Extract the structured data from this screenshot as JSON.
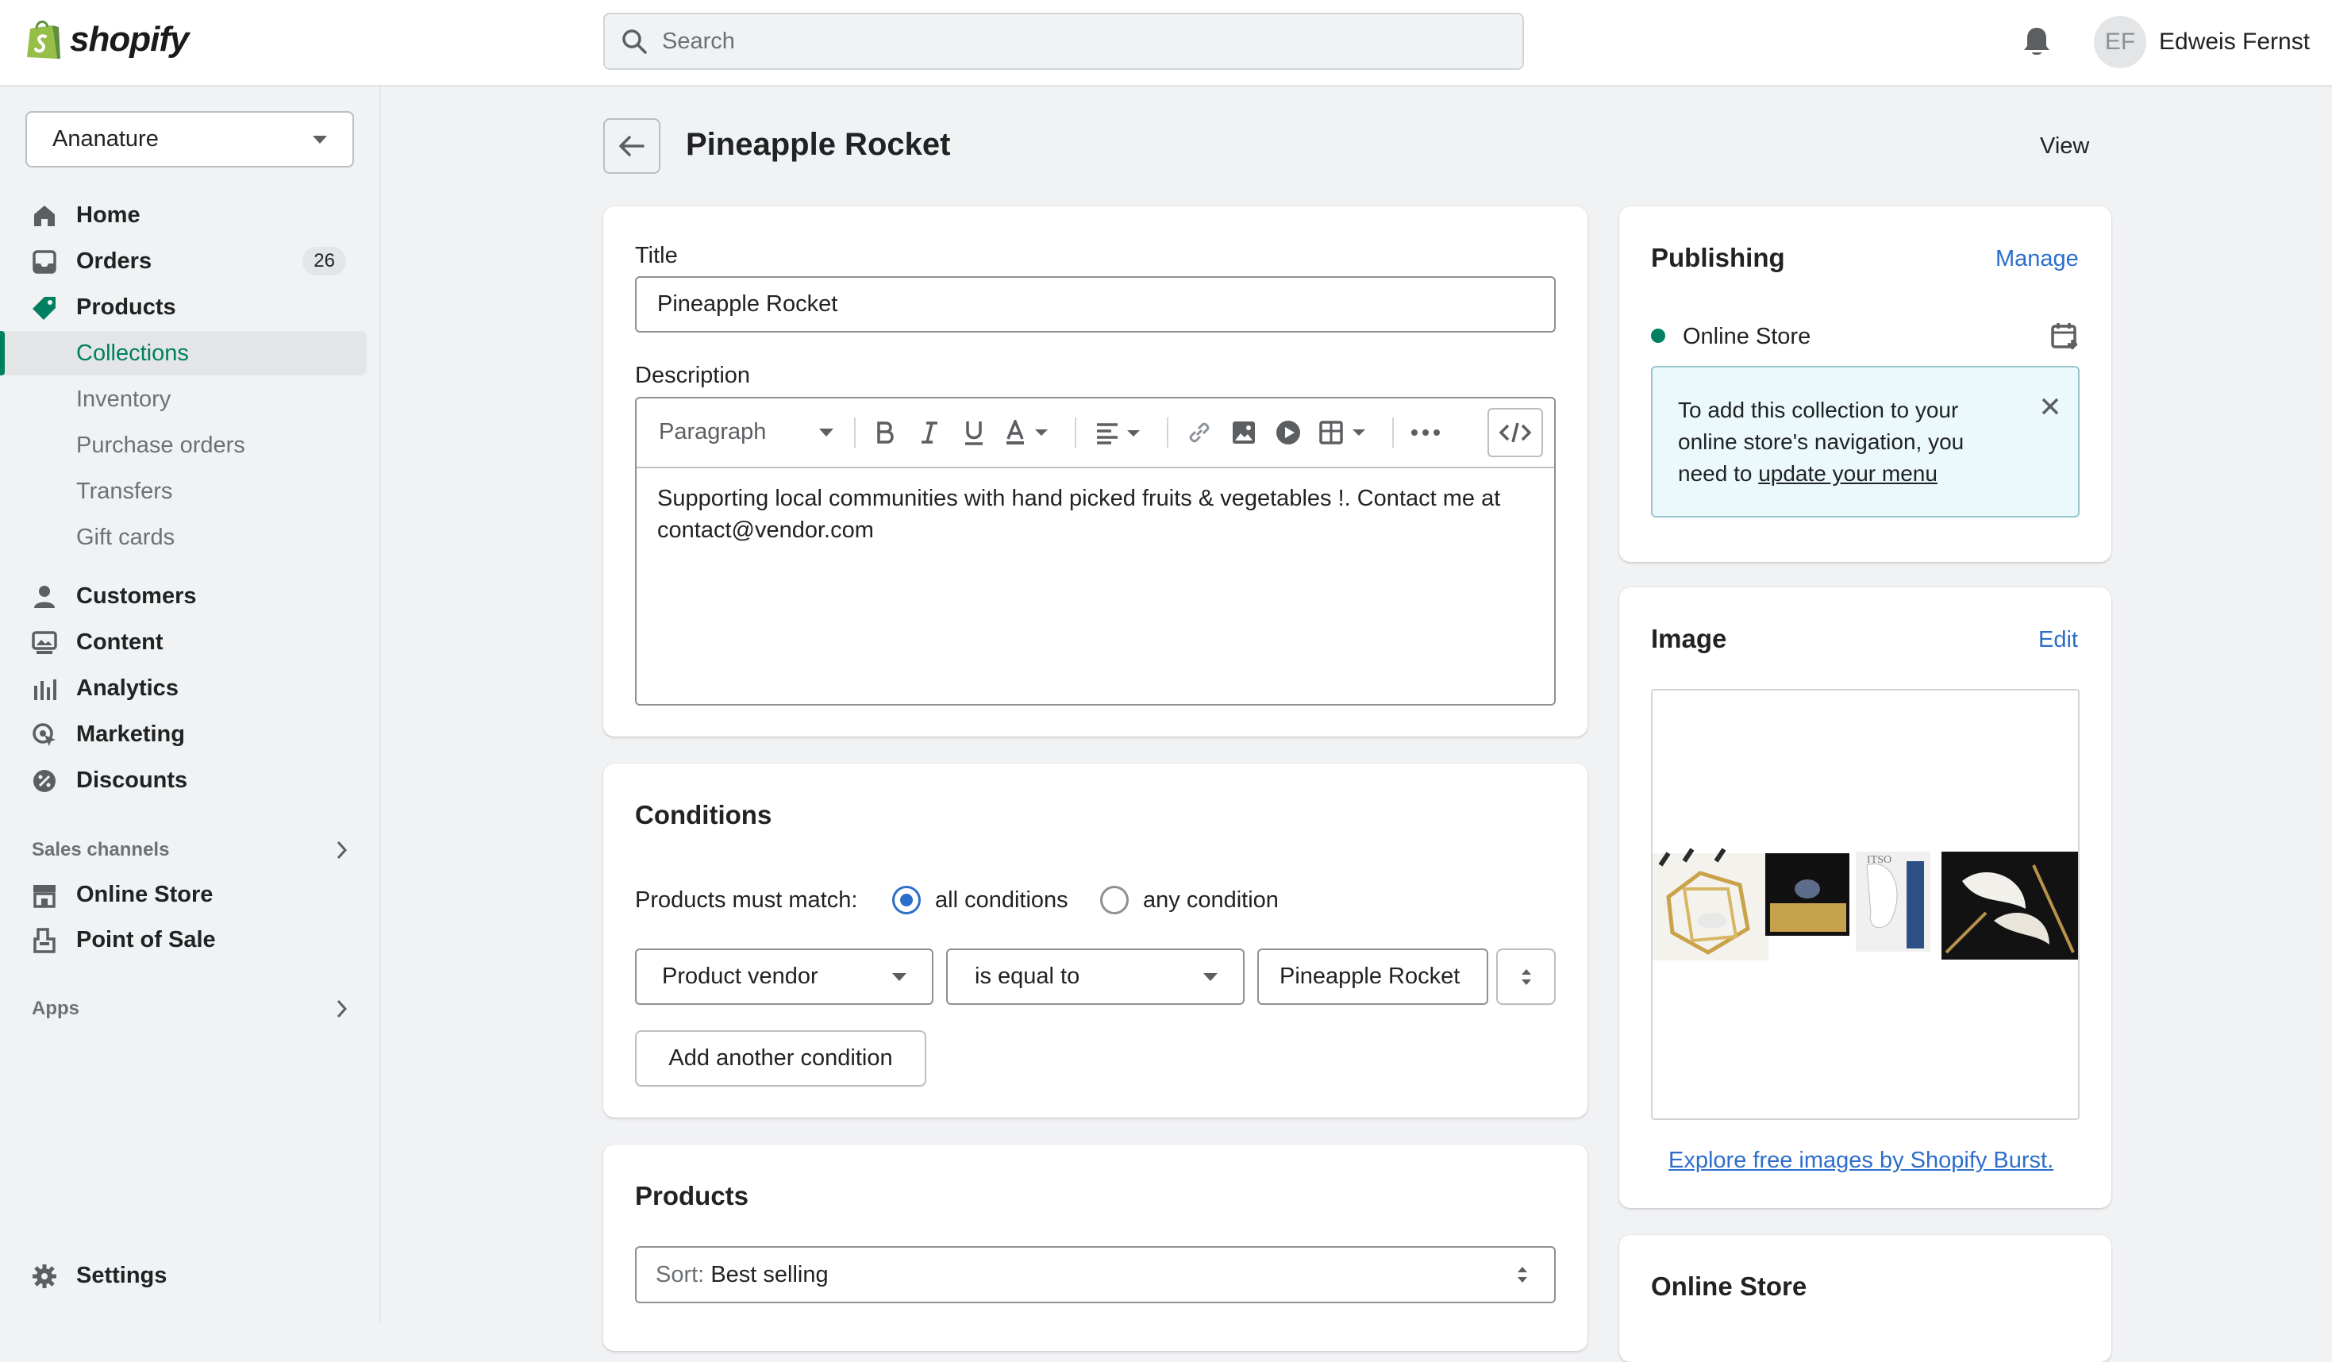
{
  "topbar": {
    "logo_text": "shopify",
    "search_placeholder": "Search",
    "user_initials": "EF",
    "user_name": "Edweis Fernst"
  },
  "sidebar": {
    "store_name": "Ananature",
    "items": [
      {
        "label": "Home",
        "icon": "home-icon"
      },
      {
        "label": "Orders",
        "icon": "orders-icon",
        "badge": "26"
      },
      {
        "label": "Products",
        "icon": "tag-icon"
      },
      {
        "label": "Collections",
        "active": true
      },
      {
        "label": "Inventory"
      },
      {
        "label": "Purchase orders"
      },
      {
        "label": "Transfers"
      },
      {
        "label": "Gift cards"
      },
      {
        "label": "Customers",
        "icon": "person-icon"
      },
      {
        "label": "Content",
        "icon": "content-icon"
      },
      {
        "label": "Analytics",
        "icon": "analytics-icon"
      },
      {
        "label": "Marketing",
        "icon": "marketing-icon"
      },
      {
        "label": "Discounts",
        "icon": "discount-icon"
      }
    ],
    "sales_channels_heading": "Sales channels",
    "channels": [
      {
        "label": "Online Store",
        "icon": "store-icon"
      },
      {
        "label": "Point of Sale",
        "icon": "pos-icon"
      }
    ],
    "apps_heading": "Apps",
    "settings_label": "Settings"
  },
  "page": {
    "title": "Pineapple Rocket",
    "view_label": "View"
  },
  "details_card": {
    "title_label": "Title",
    "title_value": "Pineapple Rocket",
    "description_label": "Description",
    "format_select": "Paragraph",
    "description_text": "Supporting local communities with hand picked fruits & vegetables !. Contact me at contact@vendor.com"
  },
  "conditions": {
    "heading": "Conditions",
    "match_label": "Products must match:",
    "option_all": "all conditions",
    "option_any": "any condition",
    "selected": "all conditions",
    "field": "Product vendor",
    "operator": "is equal to",
    "value": "Pineapple Rocket",
    "add_button": "Add another condition"
  },
  "products": {
    "heading": "Products",
    "sort_prefix": "Sort:",
    "sort_value": "Best selling"
  },
  "publishing": {
    "heading": "Publishing",
    "manage_label": "Manage",
    "channel": "Online Store",
    "channel_status_color": "#008060",
    "banner_text_1": "To add this collection to your online store's navigation, you need to ",
    "banner_link": "update your menu"
  },
  "image_card": {
    "heading": "Image",
    "edit_label": "Edit",
    "burst_link": "Explore free images by Shopify Burst."
  },
  "online_store_card": {
    "heading": "Online Store"
  },
  "colors": {
    "accent_green": "#008060",
    "link_blue": "#2c6ecb",
    "banner_bg": "#ebf9fc"
  }
}
